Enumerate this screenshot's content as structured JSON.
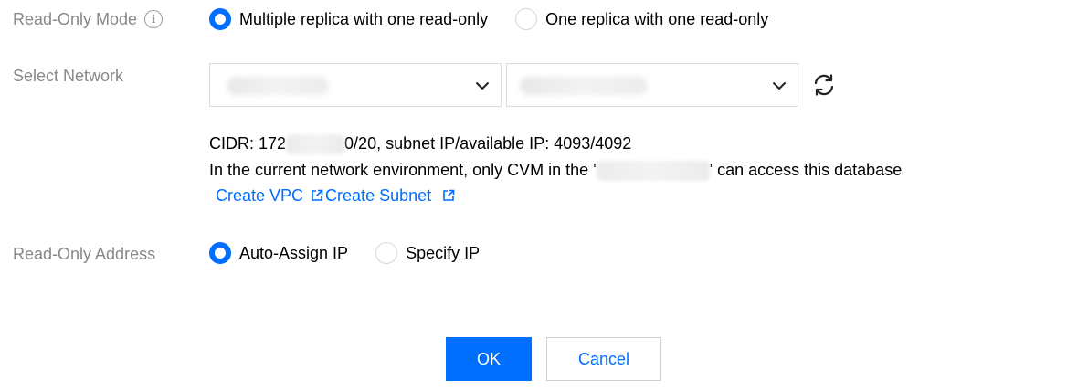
{
  "readonly_mode": {
    "label": "Read-Only Mode",
    "info_icon": "info-circle-icon",
    "options": [
      {
        "label": "Multiple replica with one read-only",
        "selected": true
      },
      {
        "label": "One replica with one read-only",
        "selected": false
      }
    ]
  },
  "network": {
    "label": "Select Network",
    "vpc_select_icon": "chevron-down-icon",
    "subnet_select_icon": "chevron-down-icon",
    "refresh_icon": "refresh-icon",
    "cidr_prefix": "CIDR: 172",
    "cidr_suffix": "0/20, subnet IP/available IP: 4093/4092",
    "env_prefix": "In the current network environment, only CVM in the '",
    "env_suffix": "' can access this database",
    "create_vpc": "Create VPC",
    "create_subnet": "Create Subnet",
    "external_link_icon": "external-link-icon"
  },
  "readonly_address": {
    "label": "Read-Only Address",
    "options": [
      {
        "label": "Auto-Assign IP",
        "selected": true
      },
      {
        "label": "Specify IP",
        "selected": false
      }
    ]
  },
  "actions": {
    "ok": "OK",
    "cancel": "Cancel"
  },
  "colors": {
    "accent": "#006eff",
    "label": "#888888",
    "border": "#dcdcdc"
  }
}
